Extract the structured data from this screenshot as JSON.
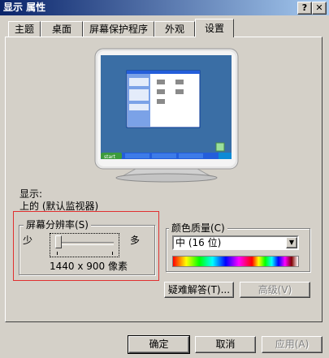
{
  "window": {
    "title": "显示 属性",
    "help_button": "?",
    "close_button": "✕"
  },
  "tabs": [
    {
      "label": "主题"
    },
    {
      "label": "桌面"
    },
    {
      "label": "屏幕保护程序"
    },
    {
      "label": "外观"
    },
    {
      "label": "设置"
    }
  ],
  "active_tab": "设置",
  "display": {
    "label": "显示:",
    "value": "上的 (默认监视器)"
  },
  "resolution": {
    "label": "屏幕分辨率(S)",
    "less": "少",
    "more": "多",
    "value_text": "1440 x 900 像素",
    "slider_level": 0.0
  },
  "color_quality": {
    "label": "颜色质量(C)",
    "selected": "中 (16 位)"
  },
  "buttons": {
    "troubleshoot": "疑难解答(T)...",
    "advanced": "高级(V)",
    "ok": "确定",
    "cancel": "取消",
    "apply": "应用(A)"
  },
  "preview": {
    "start_label": "start"
  },
  "colors": {
    "highlight_box": "#e03030",
    "desktop": "#3a6ea5",
    "taskbar": "#245edb",
    "start": "#3c9b3c"
  }
}
